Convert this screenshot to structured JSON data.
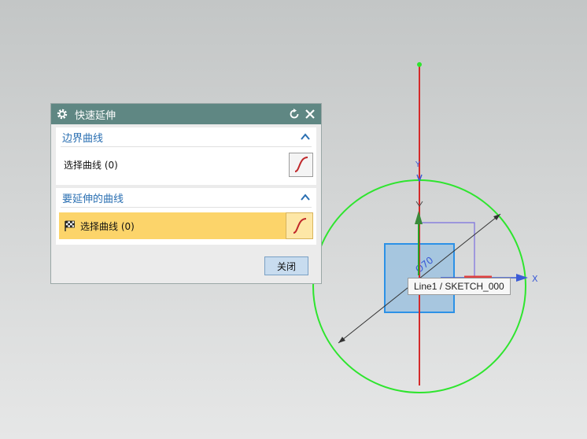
{
  "dialog": {
    "title": "快速延伸",
    "section_boundary": {
      "label": "边界曲线",
      "select_label": "选择曲线 (0)"
    },
    "section_extend": {
      "label": "要延伸的曲线",
      "select_label": "选择曲线 (0)"
    },
    "close_label": "关闭"
  },
  "viewport": {
    "dimension_label": "Ø70",
    "x_axis_label": "X",
    "tooltip": "Line1 / SKETCH_000",
    "colors": {
      "circle": "#2ee52e",
      "axis_line": "#d42a2a",
      "dimension": "#333333",
      "square_fill": "#8fb9d9",
      "square_border": "#2c91e6",
      "csys": "#6a5fd1"
    }
  }
}
